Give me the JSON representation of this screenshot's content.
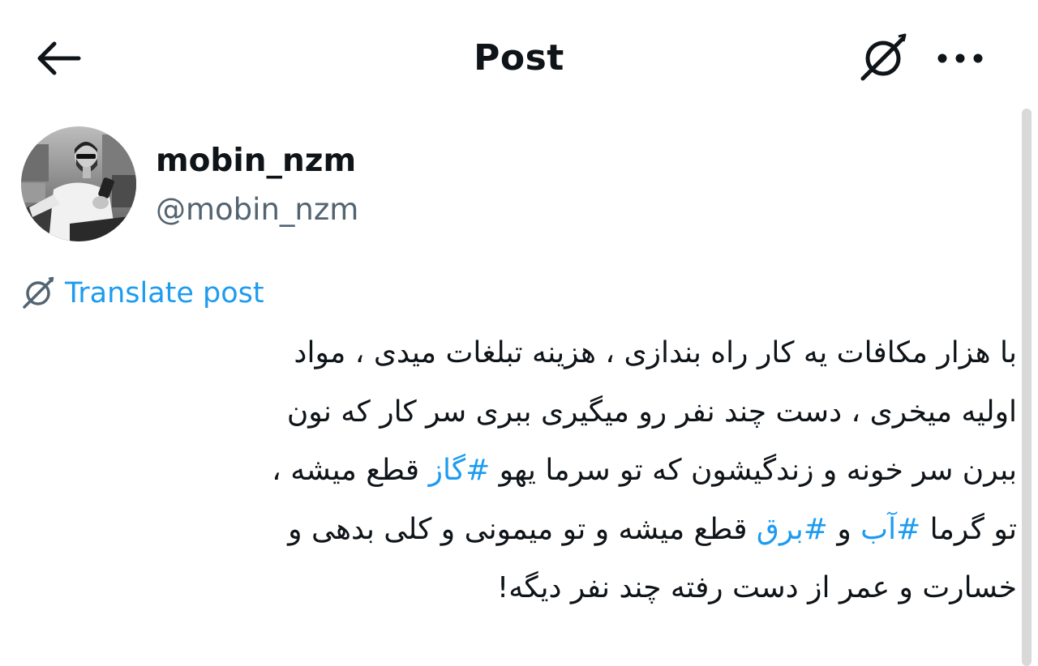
{
  "header": {
    "title": "Post",
    "back_icon": "arrow-left-icon",
    "grok_icon": "grok-icon",
    "more_icon": "more-horizontal-icon"
  },
  "author": {
    "display_name": "mobin_nzm",
    "handle": "@mobin_nzm"
  },
  "translate": {
    "label": "Translate post",
    "icon": "grok-icon"
  },
  "post": {
    "lines": [
      {
        "segments": [
          {
            "text": "با هزار مکافات یه کار راه بندازی ، هزینه تبلغات میدی ، مواد",
            "hashtag": false
          }
        ]
      },
      {
        "segments": [
          {
            "text": "اولیه میخری ، دست چند نفر رو میگیری ببری سر کار که نون",
            "hashtag": false
          }
        ]
      },
      {
        "segments": [
          {
            "text": "ببرن سر خونه و زندگیشون که تو سرما یهو ",
            "hashtag": false
          },
          {
            "text": "#گاز",
            "hashtag": true
          },
          {
            "text": " قطع میشه ،",
            "hashtag": false
          }
        ]
      },
      {
        "segments": [
          {
            "text": "تو گرما ",
            "hashtag": false
          },
          {
            "text": "#آب",
            "hashtag": true
          },
          {
            "text": " و ",
            "hashtag": false
          },
          {
            "text": "#برق",
            "hashtag": true
          },
          {
            "text": " قطع میشه و تو میمونی و کلی بدهی و",
            "hashtag": false
          }
        ]
      },
      {
        "segments": [
          {
            "text": "خسارت و عمر از دست رفته چند نفر دیگه!",
            "hashtag": false
          }
        ]
      }
    ]
  },
  "colors": {
    "text": "#0f1419",
    "secondary": "#536471",
    "link": "#1d9bf0",
    "background": "#ffffff"
  }
}
